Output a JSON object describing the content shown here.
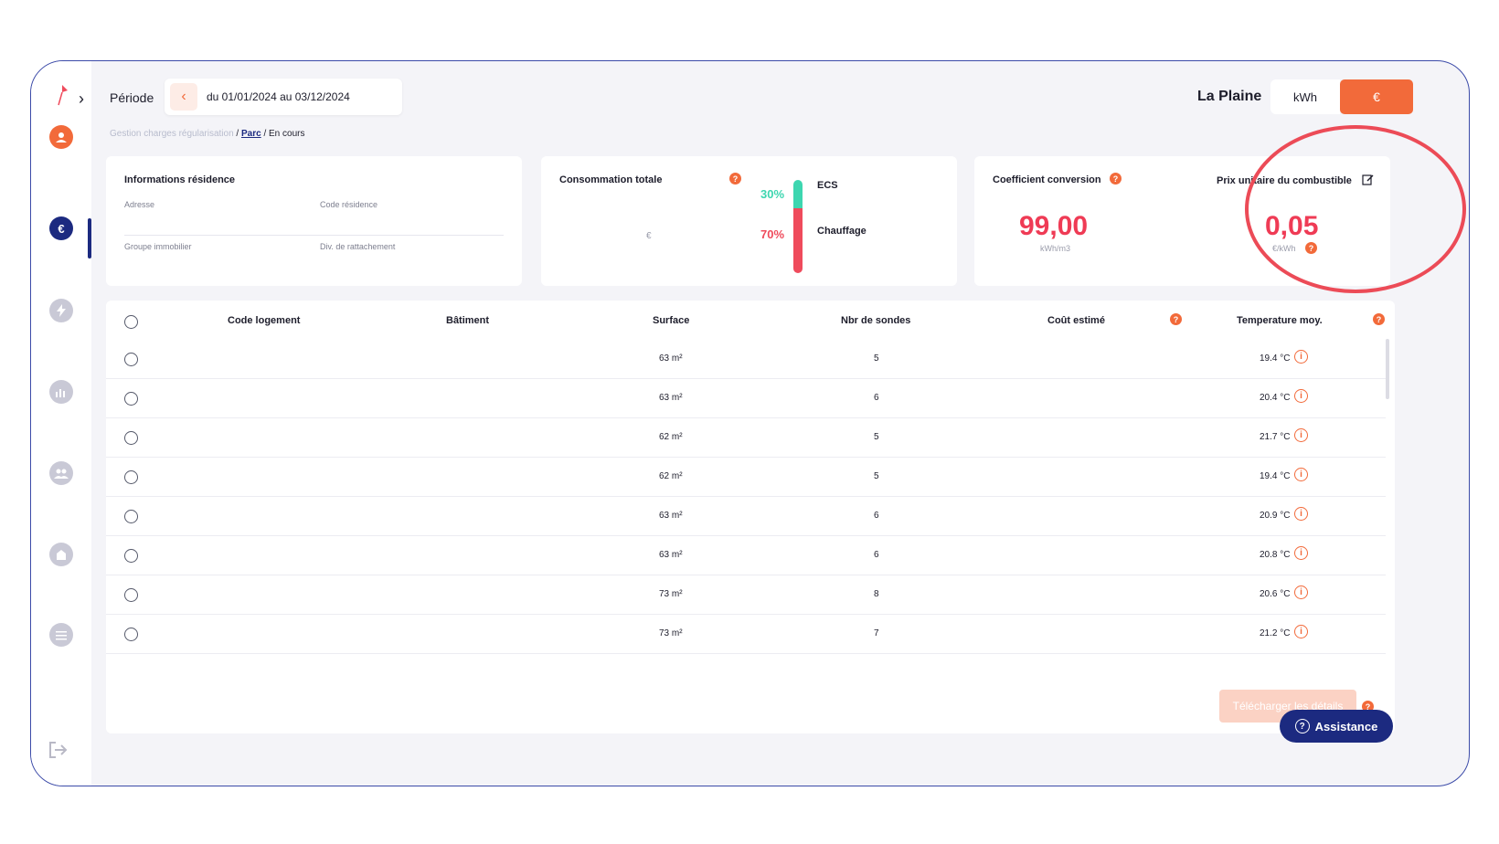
{
  "header": {
    "period_label": "Période",
    "period_value": "du 01/01/2024 au 03/12/2024",
    "site_name": "La Plaine",
    "unit_kwh": "kWh",
    "unit_eur": "€"
  },
  "breadcrumb": {
    "root": "Gestion charges régularisation",
    "sep1": " / ",
    "middle": "Parc",
    "sep2": " / ",
    "current": "En cours"
  },
  "residence": {
    "title": "Informations résidence",
    "address_label": "Adresse",
    "code_label": "Code résidence",
    "group_label": "Groupe immobilier",
    "div_label": "Div. de rattachement"
  },
  "consumption": {
    "title": "Consommation totale",
    "currency": "€",
    "ecs_pct": "30%",
    "ecs_label": "ECS",
    "chauffage_pct": "70%",
    "chauffage_label": "Chauffage",
    "ecs_fraction": 0.3,
    "chauffage_fraction": 0.7
  },
  "coefficient": {
    "title": "Coefficient conversion",
    "value": "99,00",
    "unit": "kWh/m3"
  },
  "unit_price": {
    "title": "Prix unitaire du combustible",
    "value": "0,05",
    "unit": "€/kWh"
  },
  "table": {
    "columns": [
      "Code logement",
      "Bâtiment",
      "Surface",
      "Nbr de sondes",
      "Coût estimé",
      "Temperature moy."
    ],
    "rows": [
      {
        "surface": "63 m²",
        "sondes": "5",
        "temp": "19.4 °C"
      },
      {
        "surface": "63 m²",
        "sondes": "6",
        "temp": "20.4 °C"
      },
      {
        "surface": "62 m²",
        "sondes": "5",
        "temp": "21.7 °C"
      },
      {
        "surface": "62 m²",
        "sondes": "5",
        "temp": "19.4 °C"
      },
      {
        "surface": "63 m²",
        "sondes": "6",
        "temp": "20.9 °C"
      },
      {
        "surface": "63 m²",
        "sondes": "6",
        "temp": "20.8 °C"
      },
      {
        "surface": "73 m²",
        "sondes": "8",
        "temp": "20.6 °C"
      },
      {
        "surface": "73 m²",
        "sondes": "7",
        "temp": "21.2 °C"
      }
    ]
  },
  "actions": {
    "download": "Télécharger les détails",
    "assistance": "Assistance"
  },
  "icons": {
    "help": "?",
    "info": "i",
    "prev": "‹",
    "expand": "›"
  },
  "colors": {
    "accent": "#f26a3a",
    "primary": "#1c2a80",
    "value_red": "#ef3b55",
    "ecs": "#3dd6b0",
    "chauffage": "#ef4b5c"
  }
}
